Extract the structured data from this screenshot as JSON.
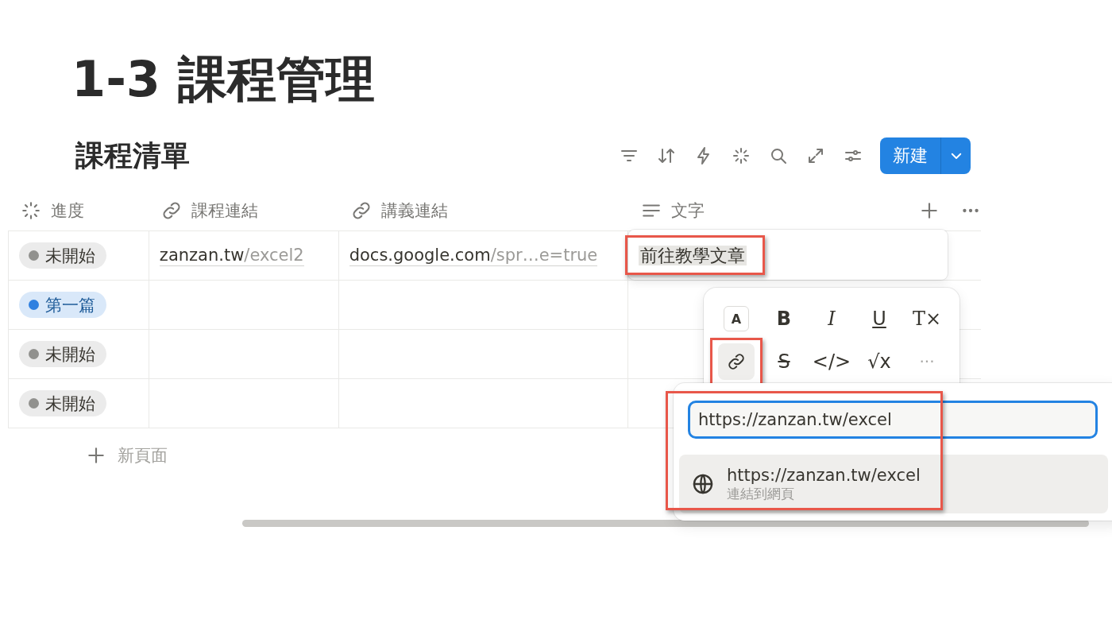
{
  "page_title": "1-3 課程管理",
  "database": {
    "title": "課程清單",
    "new_button": {
      "label": "新建"
    }
  },
  "columns": [
    {
      "kind": "status",
      "label": "進度"
    },
    {
      "kind": "url",
      "label": "課程連結"
    },
    {
      "kind": "url",
      "label": "講義連結"
    },
    {
      "kind": "text",
      "label": "文字"
    }
  ],
  "rows": [
    {
      "status": {
        "label": "未開始",
        "color": "#91918e"
      },
      "course_link": {
        "domain": "zanzan.tw",
        "path": "/excel2"
      },
      "notes_link": {
        "domain": "docs.google.com",
        "path": "/spr…e=true"
      }
    },
    {
      "status": {
        "label": "第一篇",
        "color": "#2f80e0"
      }
    },
    {
      "status": {
        "label": "未開始",
        "color": "#91918e"
      }
    },
    {
      "status": {
        "label": "未開始",
        "color": "#91918e"
      }
    }
  ],
  "add_row": {
    "label": "新頁面"
  },
  "cell_editor": {
    "text": "前往教學文章",
    "highlighted": true
  },
  "format_toolbar": [
    {
      "kind": "color",
      "label": "A",
      "selected": false,
      "highlighted": false
    },
    {
      "kind": "bold",
      "label": "B",
      "selected": false,
      "highlighted": false
    },
    {
      "kind": "italic",
      "label": "I",
      "selected": false,
      "highlighted": false
    },
    {
      "kind": "underline",
      "label": "U",
      "selected": false,
      "highlighted": false
    },
    {
      "kind": "clear",
      "label": "T×",
      "selected": false,
      "highlighted": false
    },
    {
      "kind": "link",
      "selected": true,
      "highlighted": true
    },
    {
      "kind": "strike",
      "label": "S",
      "selected": false,
      "highlighted": false
    },
    {
      "kind": "code",
      "label": "</>",
      "selected": false,
      "highlighted": false
    },
    {
      "kind": "math",
      "label": "√x",
      "selected": false,
      "highlighted": false
    },
    {
      "kind": "more",
      "label": "···",
      "selected": false,
      "highlighted": false
    }
  ],
  "link_menu": {
    "highlighted": true,
    "input": {
      "value": "https://zanzan.tw/excel"
    },
    "suggestions": [
      {
        "title": "https://zanzan.tw/excel",
        "subtitle": "連結到網頁",
        "selected": true
      }
    ]
  }
}
